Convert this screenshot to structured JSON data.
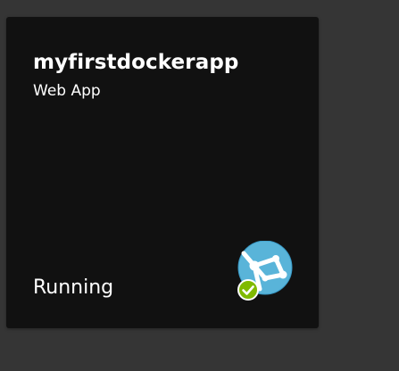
{
  "tile": {
    "name": "myfirstdockerapp",
    "type": "Web App",
    "status": "Running",
    "icon": "web-app-globe-icon",
    "status_icon": "check-circle-icon"
  },
  "colors": {
    "background": "#353535",
    "tile_background": "#111111",
    "text": "#ffffff",
    "globe": "#59b4d9",
    "status_ok": "#7fba00"
  }
}
